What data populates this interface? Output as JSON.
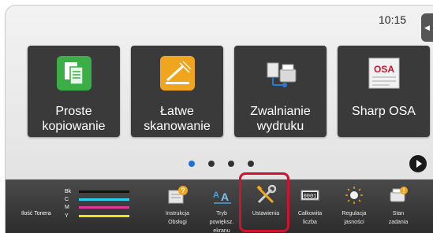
{
  "status": {
    "time": "10:15"
  },
  "tiles": [
    {
      "label_line1": "Proste",
      "label_line2": "kopiowanie",
      "icon": "copy-icon"
    },
    {
      "label_line1": "Łatwe",
      "label_line2": "skanowanie",
      "icon": "scan-icon"
    },
    {
      "label_line1": "Zwalnianie",
      "label_line2": "wydruku",
      "icon": "print-release-icon"
    },
    {
      "label_line1": "Sharp OSA",
      "label_line2": "",
      "icon": "sharp-osa-icon"
    }
  ],
  "pagination": {
    "pages": 4,
    "active": 1
  },
  "toner": {
    "label": "Ilość Tonera",
    "rows": [
      {
        "key": "Bk",
        "color": "#111111"
      },
      {
        "key": "C",
        "color": "#2ad1ee"
      },
      {
        "key": "M",
        "color": "#e0389a"
      },
      {
        "key": "Y",
        "color": "#f2e21e"
      }
    ]
  },
  "quick_buttons": [
    {
      "line1": "Instrukcja",
      "line2": "Obsługi",
      "line3": "",
      "icon": "manual-icon"
    },
    {
      "line1": "Tryb",
      "line2": "powiększ.",
      "line3": "ekranu",
      "icon": "zoom-text-icon"
    },
    {
      "line1": "Ustawienia",
      "line2": "",
      "line3": "",
      "icon": "settings-tools-icon"
    },
    {
      "line1": "Całkowita",
      "line2": "liczba",
      "line3": "",
      "icon": "counter-icon"
    },
    {
      "line1": "Regulacja",
      "line2": "jasności",
      "line3": "",
      "icon": "brightness-icon"
    },
    {
      "line1": "Stan",
      "line2": "zadania",
      "line3": "",
      "icon": "job-status-icon"
    }
  ],
  "colors": {
    "highlight": "#d0122e",
    "tile_bg": "#3a3a3a",
    "bar_bg": "#3a3a3a"
  }
}
